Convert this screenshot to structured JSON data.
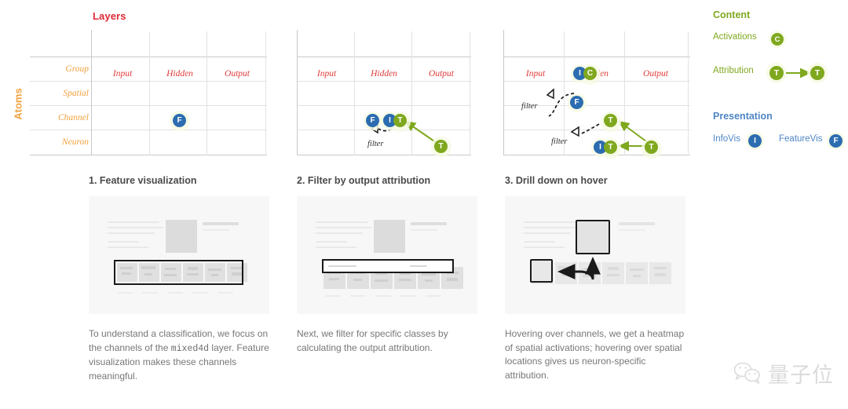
{
  "matrix": {
    "columns_title": "Layers",
    "rows_title": "Atoms",
    "columns": [
      "Input",
      "Hidden",
      "Output"
    ],
    "rows": [
      "Group",
      "Spatial",
      "Channel",
      "Neuron"
    ],
    "filter_label": "filter",
    "diagrams": [
      {
        "id": "diagram-1",
        "nodes": [
          {
            "label": "F",
            "color": "blue",
            "row": "Channel",
            "column": "Hidden"
          }
        ]
      },
      {
        "id": "diagram-2",
        "nodes": [
          {
            "label": "F",
            "color": "blue",
            "row": "Channel",
            "column": "Hidden"
          },
          {
            "label": "I",
            "color": "blue",
            "row": "Channel",
            "column": "Hidden"
          },
          {
            "label": "T",
            "color": "green",
            "row": "Channel",
            "column": "Hidden"
          },
          {
            "label": "T",
            "color": "green",
            "row": "Neuron",
            "column": "Output"
          }
        ],
        "filter_labels": [
          "filter"
        ]
      },
      {
        "id": "diagram-3",
        "nodes": [
          {
            "label": "I",
            "color": "blue",
            "row": "Spatial",
            "column": "Hidden"
          },
          {
            "label": "C",
            "color": "green",
            "row": "Spatial",
            "column": "Hidden"
          },
          {
            "label": "F",
            "color": "blue",
            "row": "Channel",
            "column": "Hidden"
          },
          {
            "label": "T",
            "color": "green",
            "row": "Channel",
            "column": "Hidden"
          },
          {
            "label": "I",
            "color": "blue",
            "row": "Neuron",
            "column": "Hidden"
          },
          {
            "label": "T",
            "color": "green",
            "row": "Neuron",
            "column": "Hidden"
          },
          {
            "label": "T",
            "color": "green",
            "row": "Neuron",
            "column": "Output"
          }
        ],
        "filter_labels": [
          "filter",
          "filter"
        ]
      }
    ]
  },
  "legend": {
    "content": {
      "heading": "Content",
      "items": [
        {
          "label": "Activations",
          "glyph": "C",
          "color": "green"
        },
        {
          "label": "Attribution",
          "glyph": "T",
          "color": "green",
          "arrow": true,
          "glyph2": "T"
        }
      ]
    },
    "presentation": {
      "heading": "Presentation",
      "items": [
        {
          "label": "InfoVis",
          "glyph": "I",
          "color": "blue"
        },
        {
          "label": "FeatureVis",
          "glyph": "F",
          "color": "blue"
        }
      ]
    }
  },
  "panels": [
    {
      "title": "1. Feature visualization",
      "caption_parts": [
        {
          "text": "To understand a classification, we focus on the channels of the ",
          "mono": false
        },
        {
          "text": "mixed4d",
          "mono": true
        },
        {
          "text": " layer. Feature visualization makes these channels meaningful.",
          "mono": false
        }
      ],
      "caption_plain": "To understand a classification, we focus on the channels of the mixed4d layer. Feature visualization makes these channels meaningful."
    },
    {
      "title": "2. Filter by output attribution",
      "caption_parts": [
        {
          "text": "Next, we filter for specific classes by calculating the output attribution.",
          "mono": false
        }
      ],
      "caption_plain": "Next, we filter for specific classes by calculating the output attribution."
    },
    {
      "title": "3. Drill down on hover",
      "caption_parts": [
        {
          "text": "Hovering over channels, we get a heatmap of spatial activations; hovering over spatial locations gives us neuron-specific attribution.",
          "mono": false
        }
      ],
      "caption_plain": "Hovering over channels, we get a heatmap of spatial activations; hovering over spatial locations gives us neuron-specific attribution."
    }
  ],
  "watermark": {
    "text": "量子位",
    "icon": "wechat-icon"
  },
  "colors": {
    "red": "#e02a35",
    "orange": "#f2a13c",
    "green": "#7fa81e",
    "blue": "#2c6cb0",
    "legend_blue": "#4f86c6",
    "grid": "#e2e2e2",
    "panel_bg": "#f7f7f7",
    "caption": "#777777"
  }
}
